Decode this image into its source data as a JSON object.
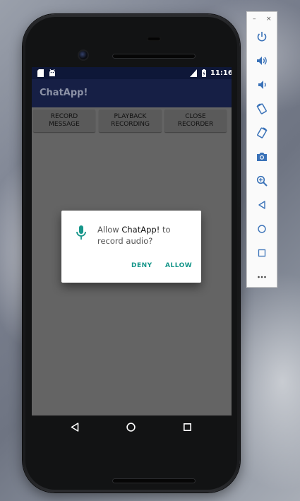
{
  "status_bar": {
    "time": "11:16"
  },
  "app": {
    "title": "ChatApp!"
  },
  "buttons": {
    "record": "RECORD\nMESSAGE",
    "playback": "PLAYBACK\nRECORDING",
    "close": "CLOSE\nRECORDER"
  },
  "dialog": {
    "prefix": "Allow ",
    "app_name": "ChatApp!",
    "suffix": " to record audio?",
    "deny": "DENY",
    "allow": "ALLOW",
    "icon": "microphone-icon"
  },
  "toolbar": {
    "minimize": "–",
    "close": "×",
    "icons": [
      "power-icon",
      "volume-up-icon",
      "volume-down-icon",
      "rotate-left-icon",
      "rotate-right-icon",
      "camera-icon",
      "zoom-icon",
      "back-icon",
      "home-icon",
      "overview-icon",
      "more-icon"
    ]
  },
  "colors": {
    "status_bar": "#0e1738",
    "app_bar": "#161f45",
    "accent": "#16968a",
    "screen_bg": "#646464"
  }
}
